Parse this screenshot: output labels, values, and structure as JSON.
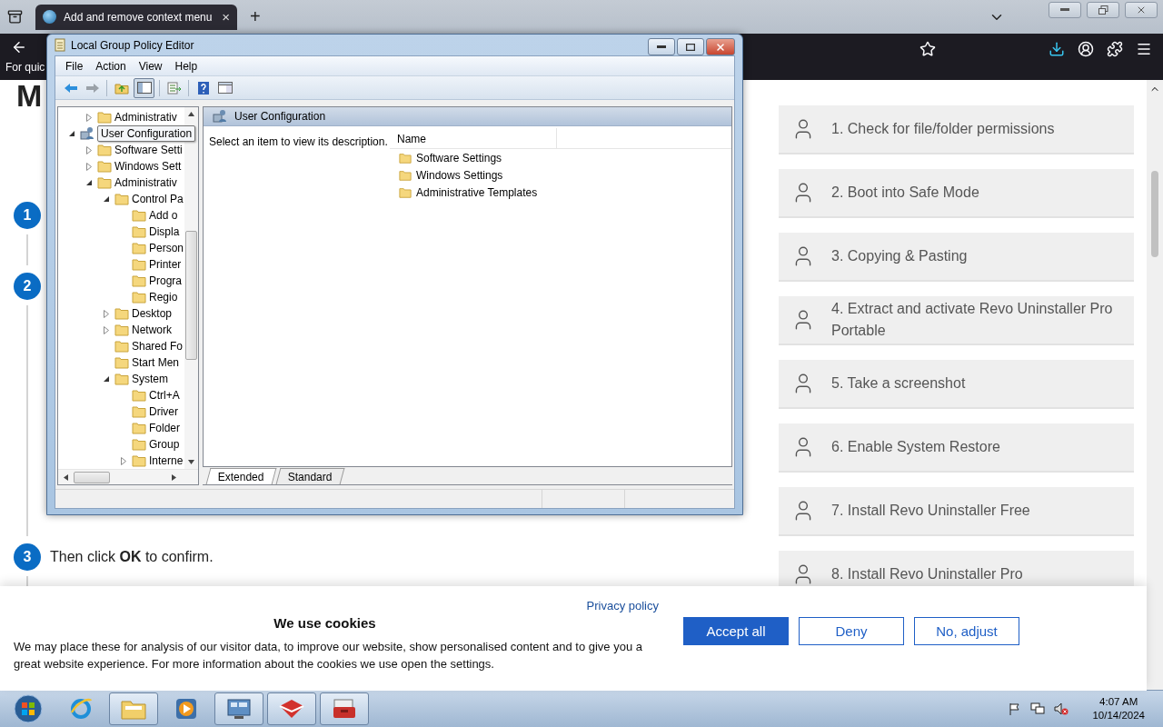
{
  "browser": {
    "tab": {
      "title": "Add and remove context menu",
      "close": "×",
      "selected": true
    },
    "new_tab": "+",
    "toolbar_text": "For quic"
  },
  "page": {
    "heading": "M",
    "steps": [
      {
        "number": "1"
      },
      {
        "number": "2"
      },
      {
        "number": "3",
        "text": "Then click **OK** to confirm."
      }
    ],
    "sidebar": [
      "1. Check for file/folder permissions",
      "2. Boot into Safe Mode",
      "3. Copying & Pasting",
      "4. Extract and activate Revo Uninstaller Pro Portable",
      "5. Take a screenshot",
      "6. Enable System Restore",
      "7. Install Revo Uninstaller Free",
      "8. Install Revo Uninstaller Pro"
    ]
  },
  "gpedit": {
    "title": "Local Group Policy Editor",
    "menu": [
      "File",
      "Action",
      "View",
      "Help"
    ],
    "tree": [
      {
        "children": [
          {
            "label": "Administrativ",
            "expanded": false
          }
        ]
      },
      {
        "label": "User Configuration",
        "kind": "user",
        "tooltip": true,
        "expanded": true,
        "children": [
          {
            "label": "Software Setti",
            "expanded": false
          },
          {
            "label": "Windows Sett",
            "expanded": false
          },
          {
            "label": "Administrativ",
            "expanded": true,
            "children": [
              {
                "label": "Control Pa",
                "expanded": true,
                "children": [
                  {
                    "label": "Add o"
                  },
                  {
                    "label": "Displa"
                  },
                  {
                    "label": "Person"
                  },
                  {
                    "label": "Printer"
                  },
                  {
                    "label": "Progra"
                  },
                  {
                    "label": "Regio"
                  }
                ]
              },
              {
                "label": "Desktop",
                "expanded": false
              },
              {
                "label": "Network",
                "expanded": false
              },
              {
                "label": "Shared Fo"
              },
              {
                "label": "Start Men"
              },
              {
                "label": "System",
                "expanded": true,
                "children": [
                  {
                    "label": "Ctrl+A"
                  },
                  {
                    "label": "Driver"
                  },
                  {
                    "label": "Folder"
                  },
                  {
                    "label": "Group"
                  },
                  {
                    "label": "Interne",
                    "expanded": false
                  }
                ]
              }
            ]
          }
        ]
      }
    ],
    "detail": {
      "heading": "User Configuration",
      "description": "Select an item to view its description.",
      "column": "Name",
      "items": [
        "Software Settings",
        "Windows Settings",
        "Administrative Templates"
      ]
    },
    "tabs": [
      {
        "label": "Extended",
        "selected": true
      },
      {
        "label": "Standard",
        "selected": false
      }
    ]
  },
  "cookies": {
    "privacy_link": "Privacy policy",
    "title": "We use cookies",
    "text": "We may place these for analysis of our visitor data, to improve our website, show personalised content and to give you a great website experience. For more information about the cookies we use open the settings.",
    "buttons": [
      {
        "label": "Accept all",
        "kind": "primary"
      },
      {
        "label": "Deny",
        "kind": "outline"
      },
      {
        "label": "No, adjust",
        "kind": "outline"
      }
    ]
  },
  "taskbar": {
    "time": "4:07 AM",
    "date": "10/14/2024"
  }
}
